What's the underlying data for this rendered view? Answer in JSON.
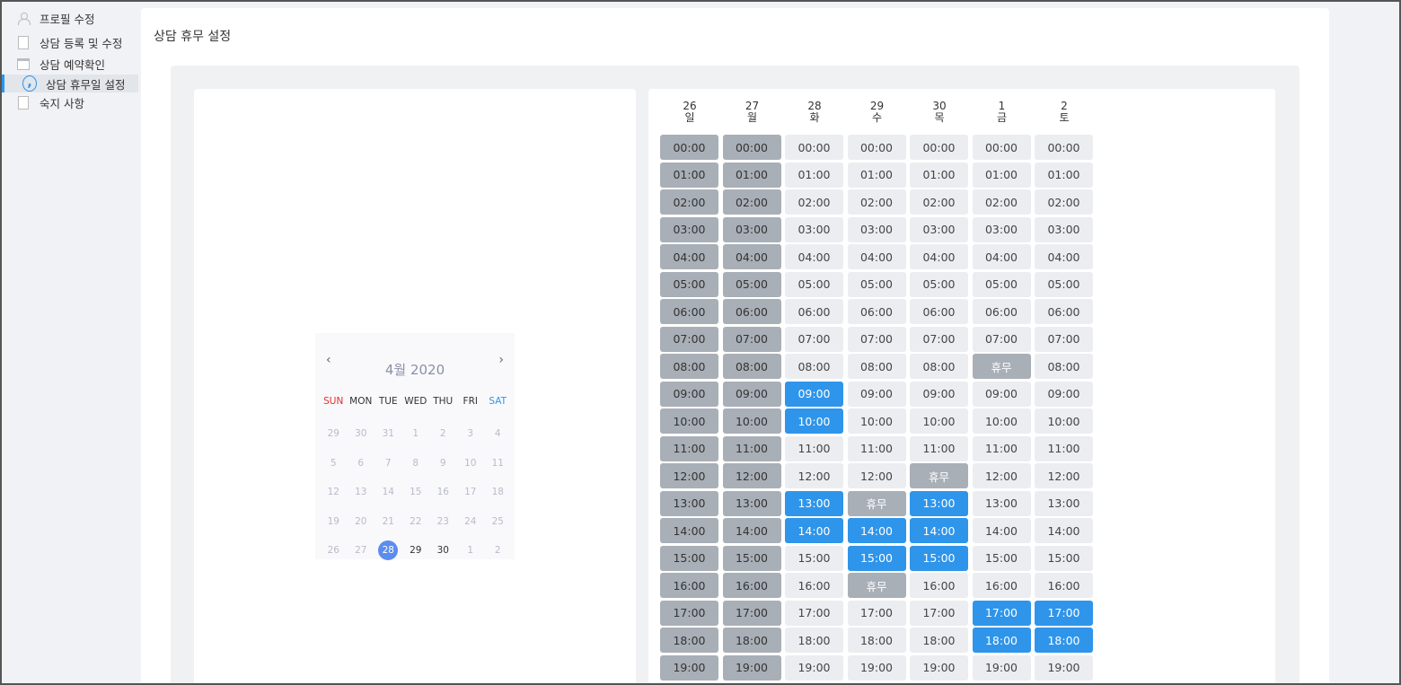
{
  "sidebar": {
    "items": [
      {
        "label": "프로필 수정",
        "icon": "user-icon"
      },
      {
        "label": "상담 등록 및 수정",
        "icon": "document-icon"
      },
      {
        "label": "상담 예약확인",
        "icon": "calendar-icon"
      },
      {
        "label": "상담 휴무일 설정",
        "icon": "quote-icon",
        "active": true
      },
      {
        "label": "숙지 사항",
        "icon": "document-icon"
      }
    ]
  },
  "page": {
    "title": "상담 휴무 설정"
  },
  "calendar": {
    "prev": "‹",
    "next": "›",
    "month_label": "4월 2020",
    "weekdays": [
      "SUN",
      "MON",
      "TUE",
      "WED",
      "THU",
      "FRI",
      "SAT"
    ],
    "weeks": [
      [
        "29",
        "30",
        "31",
        "1",
        "2",
        "3",
        "4"
      ],
      [
        "5",
        "6",
        "7",
        "8",
        "9",
        "10",
        "11"
      ],
      [
        "12",
        "13",
        "14",
        "15",
        "16",
        "17",
        "18"
      ],
      [
        "19",
        "20",
        "21",
        "22",
        "23",
        "24",
        "25"
      ],
      [
        "26",
        "27",
        "28",
        "29",
        "30",
        "1",
        "2"
      ]
    ],
    "selected": "28"
  },
  "schedule": {
    "rest_label": "휴무",
    "days": [
      {
        "date": "26",
        "weekday": "일"
      },
      {
        "date": "27",
        "weekday": "월"
      },
      {
        "date": "28",
        "weekday": "화"
      },
      {
        "date": "29",
        "weekday": "수"
      },
      {
        "date": "30",
        "weekday": "목"
      },
      {
        "date": "1",
        "weekday": "금"
      },
      {
        "date": "2",
        "weekday": "토"
      }
    ],
    "times": [
      "00:00",
      "01:00",
      "02:00",
      "03:00",
      "04:00",
      "05:00",
      "06:00",
      "07:00",
      "08:00",
      "09:00",
      "10:00",
      "11:00",
      "12:00",
      "13:00",
      "14:00",
      "15:00",
      "16:00",
      "17:00",
      "18:00",
      "19:00"
    ],
    "past_days": [
      0,
      1
    ],
    "rest_slots": [
      [
        5,
        8
      ],
      [
        4,
        12
      ],
      [
        3,
        13
      ],
      [
        3,
        16
      ]
    ],
    "booked_slots": [
      [
        2,
        9
      ],
      [
        2,
        10
      ],
      [
        2,
        13
      ],
      [
        2,
        14
      ],
      [
        3,
        14
      ],
      [
        3,
        15
      ],
      [
        4,
        13
      ],
      [
        4,
        14
      ],
      [
        4,
        15
      ],
      [
        5,
        17
      ],
      [
        5,
        18
      ],
      [
        6,
        17
      ],
      [
        6,
        18
      ]
    ]
  },
  "colors": {
    "accent": "#2f95ea",
    "past": "#a9afb7",
    "slot": "#ebedf0",
    "sunday": "#e52d2d",
    "saturday": "#2f95ea",
    "selected_date": "#5b8def"
  }
}
